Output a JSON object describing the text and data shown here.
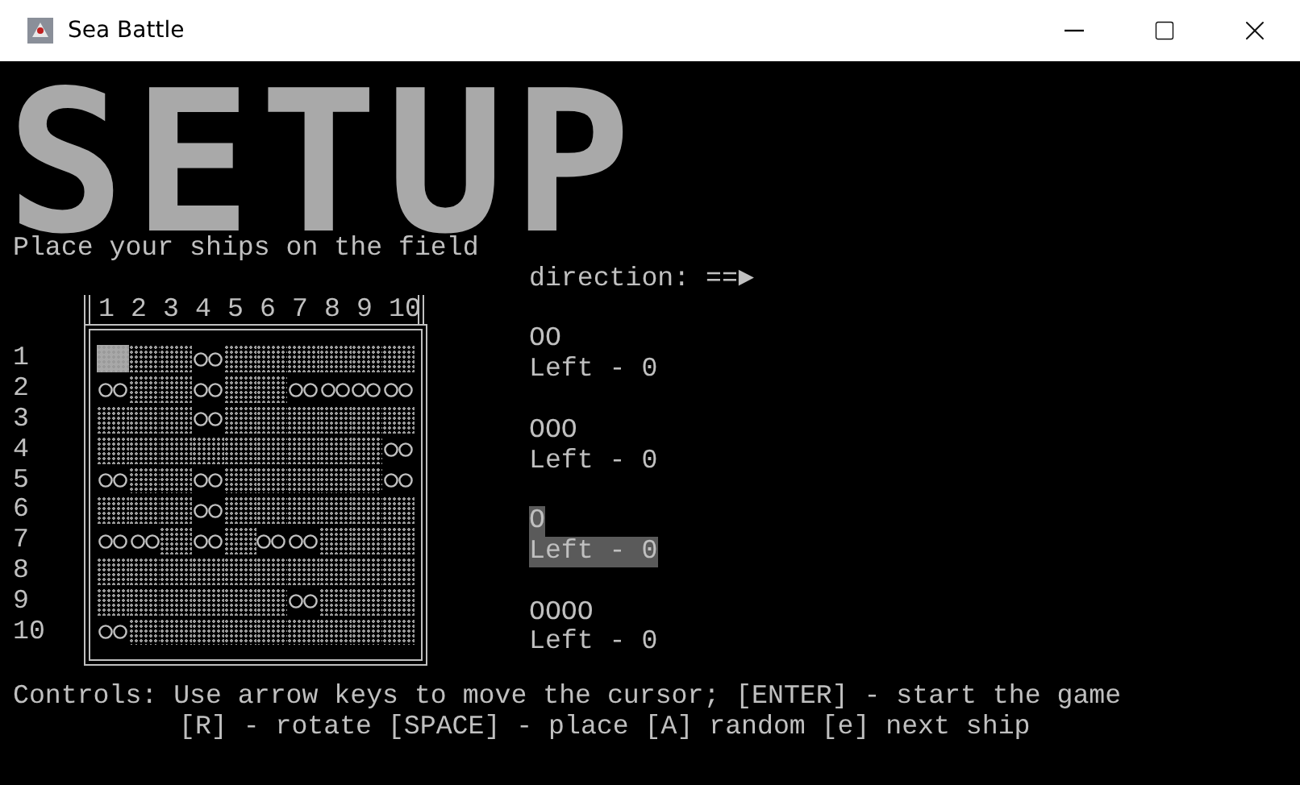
{
  "window": {
    "title": "Sea Battle"
  },
  "banner": "SETUP",
  "instruction": "Place your ships on the field",
  "direction": "direction: ==►",
  "board": {
    "columns": [
      "1",
      "2",
      "3",
      "4",
      "5",
      "6",
      "7",
      "8",
      "9",
      "10"
    ],
    "rows": [
      {
        "label": "1",
        "cells": [
          {
            "ship": false,
            "cursor": true
          },
          {
            "ship": false,
            "cursor": false
          },
          {
            "ship": false,
            "cursor": false
          },
          {
            "ship": true,
            "cursor": false
          },
          {
            "ship": false,
            "cursor": false
          },
          {
            "ship": false,
            "cursor": false
          },
          {
            "ship": false,
            "cursor": false
          },
          {
            "ship": false,
            "cursor": false
          },
          {
            "ship": false,
            "cursor": false
          },
          {
            "ship": false,
            "cursor": false
          }
        ]
      },
      {
        "label": "2",
        "cells": [
          {
            "ship": true,
            "cursor": false
          },
          {
            "ship": false,
            "cursor": false
          },
          {
            "ship": false,
            "cursor": false
          },
          {
            "ship": true,
            "cursor": false
          },
          {
            "ship": false,
            "cursor": false
          },
          {
            "ship": false,
            "cursor": false
          },
          {
            "ship": true,
            "cursor": false
          },
          {
            "ship": true,
            "cursor": false
          },
          {
            "ship": true,
            "cursor": false
          },
          {
            "ship": true,
            "cursor": false
          }
        ]
      },
      {
        "label": "3",
        "cells": [
          {
            "ship": false,
            "cursor": false
          },
          {
            "ship": false,
            "cursor": false
          },
          {
            "ship": false,
            "cursor": false
          },
          {
            "ship": true,
            "cursor": false
          },
          {
            "ship": false,
            "cursor": false
          },
          {
            "ship": false,
            "cursor": false
          },
          {
            "ship": false,
            "cursor": false
          },
          {
            "ship": false,
            "cursor": false
          },
          {
            "ship": false,
            "cursor": false
          },
          {
            "ship": false,
            "cursor": false
          }
        ]
      },
      {
        "label": "4",
        "cells": [
          {
            "ship": false,
            "cursor": false
          },
          {
            "ship": false,
            "cursor": false
          },
          {
            "ship": false,
            "cursor": false
          },
          {
            "ship": false,
            "cursor": false
          },
          {
            "ship": false,
            "cursor": false
          },
          {
            "ship": false,
            "cursor": false
          },
          {
            "ship": false,
            "cursor": false
          },
          {
            "ship": false,
            "cursor": false
          },
          {
            "ship": false,
            "cursor": false
          },
          {
            "ship": true,
            "cursor": false
          }
        ]
      },
      {
        "label": "5",
        "cells": [
          {
            "ship": true,
            "cursor": false
          },
          {
            "ship": false,
            "cursor": false
          },
          {
            "ship": false,
            "cursor": false
          },
          {
            "ship": true,
            "cursor": false
          },
          {
            "ship": false,
            "cursor": false
          },
          {
            "ship": false,
            "cursor": false
          },
          {
            "ship": false,
            "cursor": false
          },
          {
            "ship": false,
            "cursor": false
          },
          {
            "ship": false,
            "cursor": false
          },
          {
            "ship": true,
            "cursor": false
          }
        ]
      },
      {
        "label": "6",
        "cells": [
          {
            "ship": false,
            "cursor": false
          },
          {
            "ship": false,
            "cursor": false
          },
          {
            "ship": false,
            "cursor": false
          },
          {
            "ship": true,
            "cursor": false
          },
          {
            "ship": false,
            "cursor": false
          },
          {
            "ship": false,
            "cursor": false
          },
          {
            "ship": false,
            "cursor": false
          },
          {
            "ship": false,
            "cursor": false
          },
          {
            "ship": false,
            "cursor": false
          },
          {
            "ship": false,
            "cursor": false
          }
        ]
      },
      {
        "label": "7",
        "cells": [
          {
            "ship": true,
            "cursor": false
          },
          {
            "ship": true,
            "cursor": false
          },
          {
            "ship": false,
            "cursor": false
          },
          {
            "ship": true,
            "cursor": false
          },
          {
            "ship": false,
            "cursor": false
          },
          {
            "ship": true,
            "cursor": false
          },
          {
            "ship": true,
            "cursor": false
          },
          {
            "ship": false,
            "cursor": false
          },
          {
            "ship": false,
            "cursor": false
          },
          {
            "ship": false,
            "cursor": false
          }
        ]
      },
      {
        "label": "8",
        "cells": [
          {
            "ship": false,
            "cursor": false
          },
          {
            "ship": false,
            "cursor": false
          },
          {
            "ship": false,
            "cursor": false
          },
          {
            "ship": false,
            "cursor": false
          },
          {
            "ship": false,
            "cursor": false
          },
          {
            "ship": false,
            "cursor": false
          },
          {
            "ship": false,
            "cursor": false
          },
          {
            "ship": false,
            "cursor": false
          },
          {
            "ship": false,
            "cursor": false
          },
          {
            "ship": false,
            "cursor": false
          }
        ]
      },
      {
        "label": "9",
        "cells": [
          {
            "ship": false,
            "cursor": false
          },
          {
            "ship": false,
            "cursor": false
          },
          {
            "ship": false,
            "cursor": false
          },
          {
            "ship": false,
            "cursor": false
          },
          {
            "ship": false,
            "cursor": false
          },
          {
            "ship": false,
            "cursor": false
          },
          {
            "ship": true,
            "cursor": false
          },
          {
            "ship": false,
            "cursor": false
          },
          {
            "ship": false,
            "cursor": false
          },
          {
            "ship": false,
            "cursor": false
          }
        ]
      },
      {
        "label": "10",
        "cells": [
          {
            "ship": true,
            "cursor": false
          },
          {
            "ship": false,
            "cursor": false
          },
          {
            "ship": false,
            "cursor": false
          },
          {
            "ship": false,
            "cursor": false
          },
          {
            "ship": false,
            "cursor": false
          },
          {
            "ship": false,
            "cursor": false
          },
          {
            "ship": false,
            "cursor": false
          },
          {
            "ship": false,
            "cursor": false
          },
          {
            "ship": false,
            "cursor": false
          },
          {
            "ship": false,
            "cursor": false
          }
        ]
      }
    ]
  },
  "ships": [
    {
      "shape": "OO",
      "left": "Left - 0",
      "selected": false
    },
    {
      "shape": "OOO",
      "left": "Left - 0",
      "selected": false
    },
    {
      "shape": "O",
      "left": "Left - 0",
      "selected": true
    },
    {
      "shape": "OOOO",
      "left": "Left - 0",
      "selected": false
    }
  ],
  "controls": [
    "Controls: Use arrow keys to move the cursor; [ENTER] - start the game",
    "[R] - rotate [SPACE] - place [A] random [e] next ship"
  ]
}
